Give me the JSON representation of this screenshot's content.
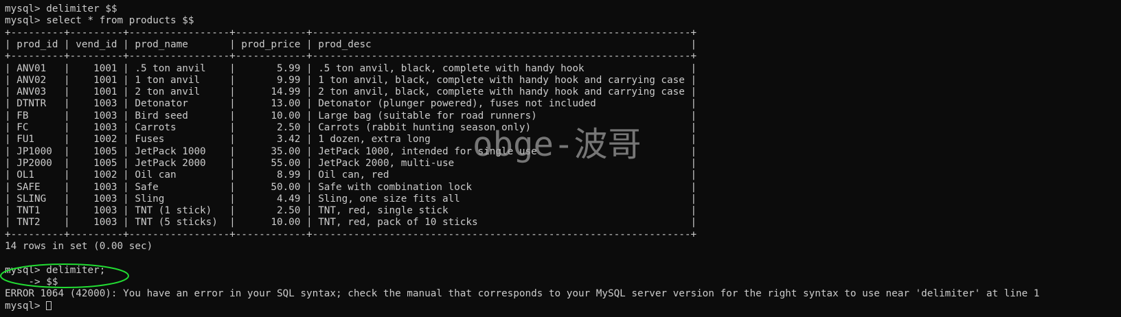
{
  "terminal": {
    "cmd1": {
      "prompt": "mysql>",
      "text": "delimiter $$"
    },
    "cmd2": {
      "prompt": "mysql>",
      "text": "select * from products $$"
    },
    "table": {
      "border": "+---------+---------+-----------------+------------+----------------------------------------------------------------+",
      "header": "| prod_id | vend_id | prod_name       | prod_price | prod_desc                                                      |",
      "rows": [
        "| ANV01   |    1001 | .5 ton anvil    |       5.99 | .5 ton anvil, black, complete with handy hook                  |",
        "| ANV02   |    1001 | 1 ton anvil     |       9.99 | 1 ton anvil, black, complete with handy hook and carrying case |",
        "| ANV03   |    1001 | 2 ton anvil     |      14.99 | 2 ton anvil, black, complete with handy hook and carrying case |",
        "| DTNTR   |    1003 | Detonator       |      13.00 | Detonator (plunger powered), fuses not included                |",
        "| FB      |    1003 | Bird seed       |      10.00 | Large bag (suitable for road runners)                          |",
        "| FC      |    1003 | Carrots         |       2.50 | Carrots (rabbit hunting season only)                           |",
        "| FU1     |    1002 | Fuses           |       3.42 | 1 dozen, extra long                                            |",
        "| JP1000  |    1005 | JetPack 1000    |      35.00 | JetPack 1000, intended for single use                          |",
        "| JP2000  |    1005 | JetPack 2000    |      55.00 | JetPack 2000, multi-use                                        |",
        "| OL1     |    1002 | Oil can         |       8.99 | Oil can, red                                                   |",
        "| SAFE    |    1003 | Safe            |      50.00 | Safe with combination lock                                     |",
        "| SLING   |    1003 | Sling           |       4.49 | Sling, one size fits all                                       |",
        "| TNT1    |    1003 | TNT (1 stick)   |       2.50 | TNT, red, single stick                                         |",
        "| TNT2    |    1003 | TNT (5 sticks)  |      10.00 | TNT, red, pack of 10 sticks                                    |"
      ]
    },
    "result_summary": "14 rows in set (0.00 sec)",
    "cmd3": {
      "prompt": "mysql>",
      "text": "delimiter;"
    },
    "continuation": {
      "prompt": "    ->",
      "text": "$$"
    },
    "error": "ERROR 1064 (42000): You have an error in your SQL syntax; check the manual that corresponds to your MySQL server version for the right syntax to use near 'delimiter' at line 1",
    "cmd4": {
      "prompt": "mysql>",
      "text": ""
    }
  },
  "watermark": "obge-波哥",
  "colors": {
    "background": "#0c0c0c",
    "text": "#cccccc",
    "annotation_circle": "#22dd33",
    "watermark": "#a0a0a0"
  }
}
